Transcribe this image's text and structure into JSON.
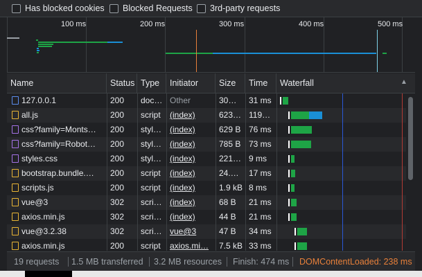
{
  "filters": [
    {
      "label": "Has blocked cookies",
      "checked": false
    },
    {
      "label": "Blocked Requests",
      "checked": false
    },
    {
      "label": "3rd-party requests",
      "checked": false
    }
  ],
  "overview": {
    "ticks": [
      "100 ms",
      "200 ms",
      "300 ms",
      "400 ms",
      "500 ms"
    ]
  },
  "columns": [
    "Name",
    "Status",
    "Type",
    "Initiator",
    "Size",
    "Time",
    "Waterfall"
  ],
  "sort_indicator": "▲",
  "rows": [
    {
      "name": "127.0.0.1",
      "icon": "document-icon",
      "status": "200",
      "type": "doc…",
      "initiator": "Other",
      "initiator_link": false,
      "size": "30…",
      "time": "31 ms"
    },
    {
      "name": "all.js",
      "icon": "script-icon",
      "status": "200",
      "type": "script",
      "initiator": "(index)",
      "initiator_link": true,
      "size": "623…",
      "time": "119…"
    },
    {
      "name": "css?family=Monts…",
      "icon": "stylesheet-icon",
      "status": "200",
      "type": "styl…",
      "initiator": "(index)",
      "initiator_link": true,
      "size": "629 B",
      "time": "76 ms"
    },
    {
      "name": "css?family=Robot…",
      "icon": "stylesheet-icon",
      "status": "200",
      "type": "styl…",
      "initiator": "(index)",
      "initiator_link": true,
      "size": "785 B",
      "time": "73 ms"
    },
    {
      "name": "styles.css",
      "icon": "stylesheet-icon",
      "status": "200",
      "type": "styl…",
      "initiator": "(index)",
      "initiator_link": true,
      "size": "221…",
      "time": "9 ms"
    },
    {
      "name": "bootstrap.bundle.…",
      "icon": "script-icon",
      "status": "200",
      "type": "script",
      "initiator": "(index)",
      "initiator_link": true,
      "size": "24.…",
      "time": "17 ms"
    },
    {
      "name": "scripts.js",
      "icon": "script-icon",
      "status": "200",
      "type": "script",
      "initiator": "(index)",
      "initiator_link": true,
      "size": "1.9 kB",
      "time": "8 ms"
    },
    {
      "name": "vue@3",
      "icon": "script-icon",
      "status": "302",
      "type": "scri…",
      "initiator": "(index)",
      "initiator_link": true,
      "size": "68 B",
      "time": "21 ms"
    },
    {
      "name": "axios.min.js",
      "icon": "script-icon",
      "status": "302",
      "type": "scri…",
      "initiator": "(index)",
      "initiator_link": true,
      "size": "44 B",
      "time": "21 ms"
    },
    {
      "name": "vue@3.2.38",
      "icon": "script-icon",
      "status": "302",
      "type": "scri…",
      "initiator": "vue@3",
      "initiator_link": true,
      "size": "47 B",
      "time": "34 ms"
    },
    {
      "name": "axios.min.js",
      "icon": "script-icon",
      "status": "200",
      "type": "script",
      "initiator": "axios.mi…",
      "initiator_link": true,
      "size": "7.5 kB",
      "time": "33 ms"
    }
  ],
  "status_bar": {
    "requests": "19 requests",
    "transferred": "1.5 MB transferred",
    "resources": "3.2 MB resources",
    "finish": "Finish: 474 ms",
    "dcl": "DOMContentLoaded: 238 ms"
  },
  "colors": {
    "waiting": "#ffffff",
    "download_green": "#1ea446",
    "download_blue": "#1a8fd6",
    "dcl_line": "#2a58d8",
    "load_line": "#b33c35",
    "dcl_text": "#e8803a",
    "script_icon": "#e9b535",
    "stylesheet_icon": "#a673e8",
    "document_icon": "#5b8def"
  }
}
